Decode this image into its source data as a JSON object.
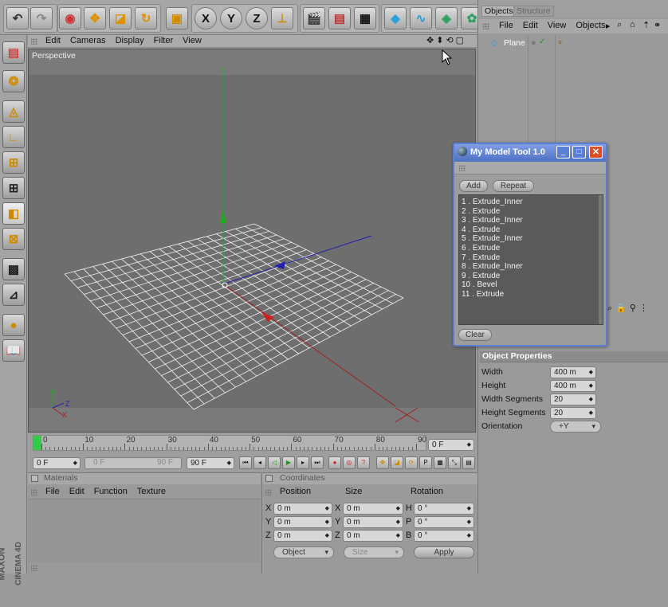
{
  "top_toolbar": {
    "axis_x": "X",
    "axis_y": "Y",
    "axis_z": "Z"
  },
  "viewport": {
    "menu": [
      "Edit",
      "Cameras",
      "Display",
      "Filter",
      "View"
    ],
    "label": "Perspective"
  },
  "objects_panel": {
    "tabs": [
      "Objects",
      "Structure"
    ],
    "menu": [
      "File",
      "Edit",
      "View",
      "Objects"
    ],
    "item": "Plane"
  },
  "tool_window": {
    "title": "My Model Tool 1.0",
    "add_label": "Add",
    "repeat_label": "Repeat",
    "clear_label": "Clear",
    "items": [
      "1 . Extrude_Inner",
      "2 . Extrude",
      "3 . Extrude_Inner",
      "4 . Extrude",
      "5 . Extrude_Inner",
      "6 . Extrude",
      "7 . Extrude",
      "8 . Extrude_Inner",
      "9 . Extrude",
      "10 . Bevel",
      "11 . Extrude"
    ]
  },
  "properties": {
    "header": "Object Properties",
    "rows": [
      {
        "label": "Width",
        "value": "400 m"
      },
      {
        "label": "Height",
        "value": "400 m"
      },
      {
        "label": "Width Segments",
        "value": "20"
      },
      {
        "label": "Height Segments",
        "value": "20"
      },
      {
        "label": "Orientation",
        "value": "+Y"
      }
    ]
  },
  "timeline": {
    "ticks": [
      "0",
      "10",
      "20",
      "30",
      "40",
      "50",
      "60",
      "70",
      "80",
      "90"
    ],
    "current_frame": "0 F",
    "start": "0 F",
    "range_start": "0 F",
    "range_end": "90 F",
    "end": "90 F"
  },
  "materials": {
    "title": "Materials",
    "menu": [
      "File",
      "Edit",
      "Function",
      "Texture"
    ]
  },
  "coordinates": {
    "title": "Coordinates",
    "headers": [
      "Position",
      "Size",
      "Rotation"
    ],
    "pos_labels": [
      "X",
      "Y",
      "Z"
    ],
    "size_labels": [
      "X",
      "Y",
      "Z"
    ],
    "rot_labels": [
      "H",
      "P",
      "B"
    ],
    "pos_values": [
      "0 m",
      "0 m",
      "0 m"
    ],
    "size_values": [
      "0 m",
      "0 m",
      "0 m"
    ],
    "rot_values": [
      "0 °",
      "0 °",
      "0 °"
    ],
    "mode": "Object",
    "size_mode": "Size",
    "apply_label": "Apply"
  },
  "brand": {
    "line1": "MAXON",
    "line2": "CINEMA 4D"
  },
  "colors": {
    "viewport_bg": "#6e6e6e",
    "panel_bg": "#9a9a9a",
    "tool_title": "#5a7ac8",
    "list_bg": "#5a5a5a"
  }
}
